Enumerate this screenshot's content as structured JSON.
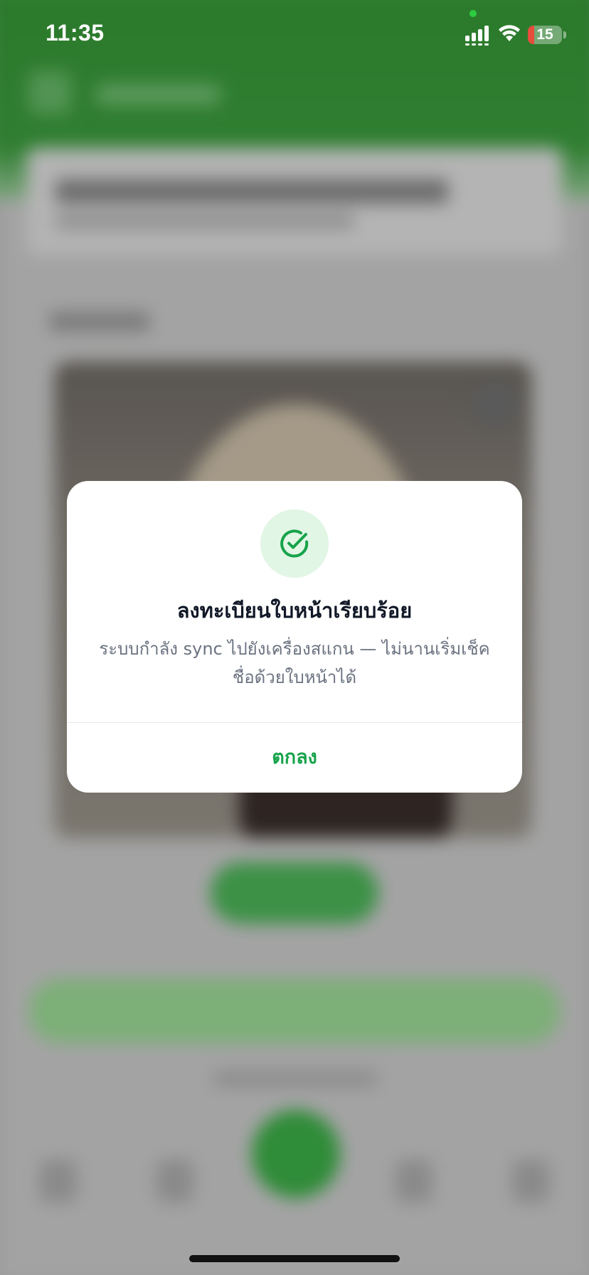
{
  "status_bar": {
    "time": "11:35",
    "battery_level": "15",
    "battery_color": "#e74c3c"
  },
  "dialog": {
    "icon": "check-circle-icon",
    "title": "ลงทะเบียนใบหน้าเรียบร้อย",
    "message_line1": "ระบบกำลัง sync ไปยังเครื่องสแกน — ไม่นานเริ่มเช็ค",
    "message_line2": "ชื่อด้วยใบหน้าได้",
    "ok_label": "ตกลง"
  },
  "colors": {
    "accent_green": "#16a34a",
    "header_green": "#2f7e31",
    "icon_bg": "#e2f6e5"
  }
}
